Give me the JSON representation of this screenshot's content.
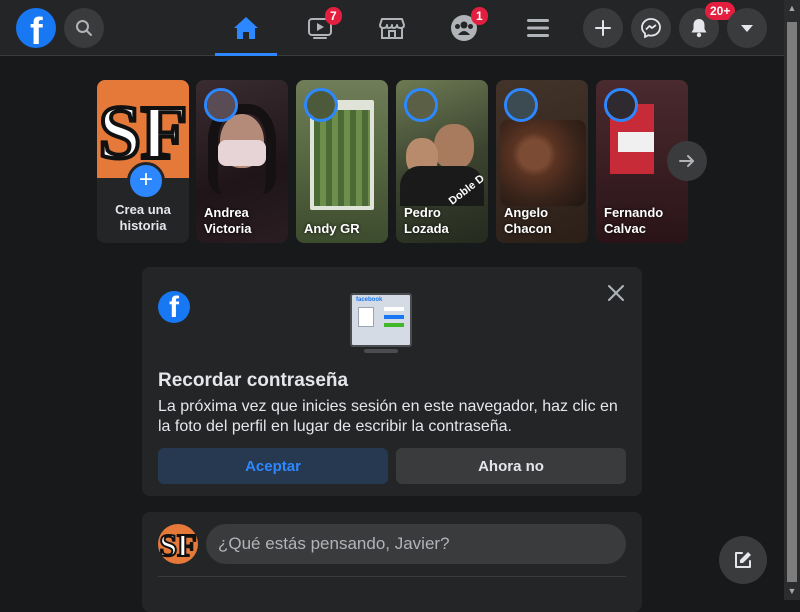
{
  "topbar": {
    "logo_letter": "f",
    "badges": {
      "watch": "7",
      "groups": "1",
      "notifications": "20+"
    }
  },
  "stories": {
    "create": {
      "label_line1": "Crea una",
      "label_line2": "historia",
      "logo_text": "SF"
    },
    "items": [
      {
        "name_line1": "Andrea",
        "name_line2": "Victoria",
        "bg": "#2a1e22"
      },
      {
        "name_line1": "Andy GR",
        "name_line2": "",
        "bg": "#4d5c3a"
      },
      {
        "name_line1": "Pedro",
        "name_line2": "Lozada",
        "bg": "#3e4733",
        "overlay": "Doble D"
      },
      {
        "name_line1": "Angelo",
        "name_line2": "Chacon",
        "bg": "#3b2a22"
      },
      {
        "name_line1": "Fernando",
        "name_line2": "Calvac",
        "bg": "#3a2025"
      }
    ]
  },
  "password_card": {
    "logo_letter": "f",
    "title": "Recordar contraseña",
    "body": "La próxima vez que inicies sesión en este navegador, haz clic en la foto del perfil en lugar de escribir la contraseña.",
    "accept": "Aceptar",
    "decline": "Ahora no",
    "illustration_label": "facebook"
  },
  "composer": {
    "placeholder": "¿Qué estás pensando, Javier?",
    "avatar_text": "SF"
  },
  "colors": {
    "accent": "#2d88ff",
    "badge": "#e41e3f",
    "surface": "#242526",
    "background": "#18191a"
  }
}
